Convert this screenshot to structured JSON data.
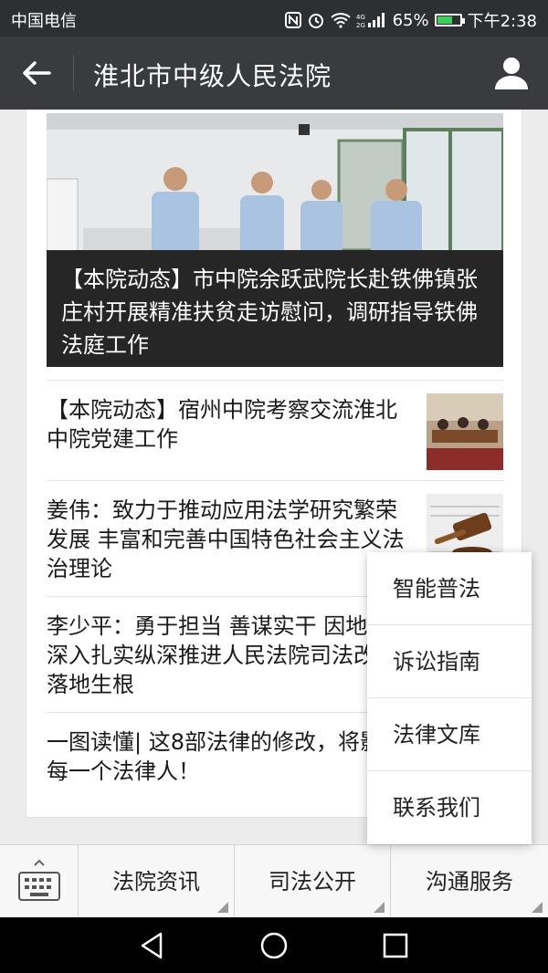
{
  "status_bar": {
    "carrier": "中国电信",
    "battery_percent": "65%",
    "battery_level": 0.65,
    "time": "下午2:38",
    "icons": [
      "nfc-icon",
      "alarm-icon",
      "wifi-icon",
      "signal-icon",
      "battery-icon"
    ]
  },
  "header": {
    "title": "淮北市中级人民法院",
    "back_icon": "arrow-left-icon",
    "profile_icon": "person-icon"
  },
  "hero": {
    "caption": "【本院动态】市中院余跃武院长赴铁佛镇张庄村开展精准扶贫走访慰问，调研指导铁佛法庭工作"
  },
  "news": [
    {
      "title": "【本院动态】宿州中院考察交流淮北中院党建工作"
    },
    {
      "title": "姜伟：致力于推动应用法学研究繁荣发展 丰富和完善中国特色社会主义法治理论"
    },
    {
      "title": "李少平：勇于担当 善谋实干 因地制宜 深入扎实纵深推进人民法院司法改革落地生根"
    },
    {
      "title": "一图读懂| 这8部法律的修改，将影响每一个法律人！"
    }
  ],
  "popup_menu": [
    {
      "label": "智能普法"
    },
    {
      "label": "诉讼指南"
    },
    {
      "label": "法律文库"
    },
    {
      "label": "联系我们"
    }
  ],
  "bottom_menu": [
    {
      "label": "法院资讯"
    },
    {
      "label": "司法公开"
    },
    {
      "label": "沟通服务"
    }
  ],
  "colors": {
    "status_bar": "#2e2f32",
    "header": "#3a3b3f",
    "battery_fill": "#3ecf5c"
  }
}
